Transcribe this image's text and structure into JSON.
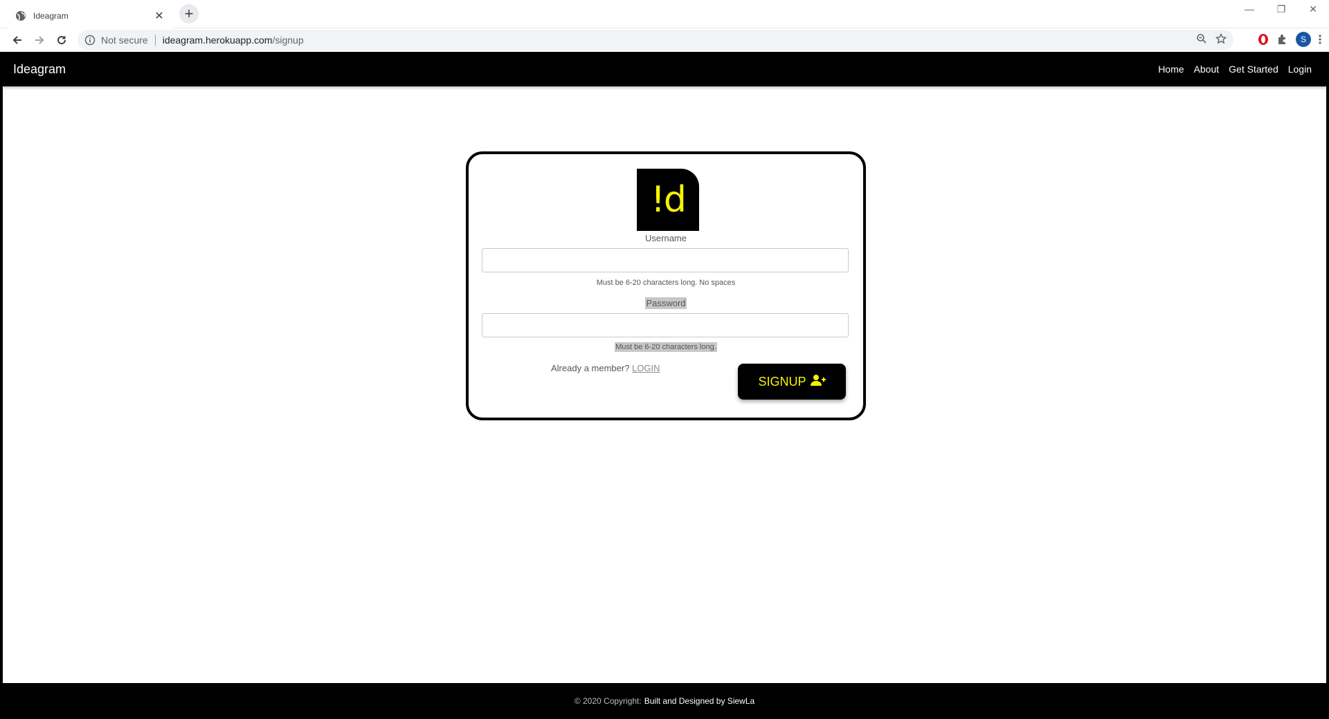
{
  "browser": {
    "tab_title": "Ideagram",
    "security_label": "Not secure",
    "url_host": "ideagram.herokuapp.com",
    "url_path": "/signup",
    "avatar_letter": "S"
  },
  "navbar": {
    "brand": "Ideagram",
    "links": [
      "Home",
      "About",
      "Get Started",
      "Login"
    ]
  },
  "form": {
    "logo_text": "!d",
    "username_label": "Username",
    "username_value": "",
    "username_hint": "Must be 6-20 characters long. No spaces",
    "password_label": "Password",
    "password_value": "",
    "password_hint": "Must be 6-20 characters long.",
    "member_text": "Already a member?",
    "login_link": "LOGIN",
    "signup_label": "SIGNUP"
  },
  "footer": {
    "copyright": "© 2020 Copyright:",
    "credit": "Built and Designed by SiewLa"
  },
  "colors": {
    "brand_black": "#000000",
    "accent_yellow": "#f5f500"
  },
  "icons": {
    "favicon": "globe-icon",
    "signup": "user-plus-icon"
  }
}
